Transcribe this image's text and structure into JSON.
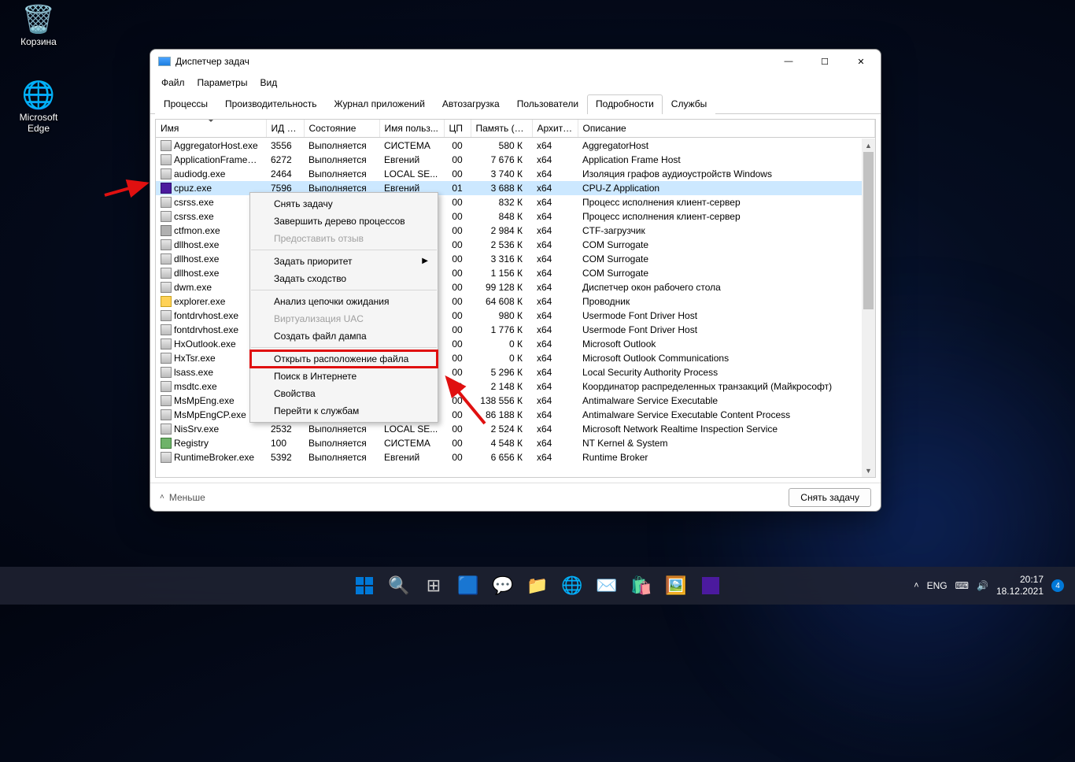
{
  "desktop": {
    "recycle": "Корзина",
    "edge": "Microsoft Edge"
  },
  "window": {
    "title": "Диспетчер задач",
    "menu": {
      "file": "Файл",
      "params": "Параметры",
      "view": "Вид"
    },
    "tabs": [
      "Процессы",
      "Производительность",
      "Журнал приложений",
      "Автозагрузка",
      "Пользователи",
      "Подробности",
      "Службы"
    ],
    "activeTab": 5,
    "headers": [
      "Имя",
      "ИД п...",
      "Состояние",
      "Имя польз...",
      "ЦП",
      "Память (а...",
      "Архите...",
      "Описание"
    ],
    "rows": [
      {
        "ic": "exe",
        "name": "AggregatorHost.exe",
        "pid": "3556",
        "state": "Выполняется",
        "user": "СИСТЕМА",
        "cpu": "00",
        "mem": "580 К",
        "arch": "x64",
        "desc": "AggregatorHost"
      },
      {
        "ic": "exe",
        "name": "ApplicationFrameHo...",
        "pid": "6272",
        "state": "Выполняется",
        "user": "Евгений",
        "cpu": "00",
        "mem": "7 676 К",
        "arch": "x64",
        "desc": "Application Frame Host"
      },
      {
        "ic": "exe",
        "name": "audiodg.exe",
        "pid": "2464",
        "state": "Выполняется",
        "user": "LOCAL SE...",
        "cpu": "00",
        "mem": "3 740 К",
        "arch": "x64",
        "desc": "Изоляция графов аудиоустройств Windows"
      },
      {
        "ic": "cpuz",
        "name": "cpuz.exe",
        "pid": "7596",
        "state": "Выполняется",
        "user": "Евгений",
        "cpu": "01",
        "mem": "3 688 К",
        "arch": "x64",
        "desc": "CPU-Z Application",
        "sel": true
      },
      {
        "ic": "exe",
        "name": "csrss.exe",
        "pid": "",
        "state": "",
        "user": "",
        "cpu": "00",
        "mem": "832 К",
        "arch": "x64",
        "desc": "Процесс исполнения клиент-сервер"
      },
      {
        "ic": "exe",
        "name": "csrss.exe",
        "pid": "",
        "state": "",
        "user": "",
        "cpu": "00",
        "mem": "848 К",
        "arch": "x64",
        "desc": "Процесс исполнения клиент-сервер"
      },
      {
        "ic": "pen",
        "name": "ctfmon.exe",
        "pid": "",
        "state": "",
        "user": "",
        "cpu": "00",
        "mem": "2 984 К",
        "arch": "x64",
        "desc": "CTF-загрузчик"
      },
      {
        "ic": "exe",
        "name": "dllhost.exe",
        "pid": "",
        "state": "",
        "user": "",
        "cpu": "00",
        "mem": "2 536 К",
        "arch": "x64",
        "desc": "COM Surrogate"
      },
      {
        "ic": "exe",
        "name": "dllhost.exe",
        "pid": "",
        "state": "",
        "user": "",
        "cpu": "00",
        "mem": "3 316 К",
        "arch": "x64",
        "desc": "COM Surrogate"
      },
      {
        "ic": "exe",
        "name": "dllhost.exe",
        "pid": "",
        "state": "",
        "user": "",
        "cpu": "00",
        "mem": "1 156 К",
        "arch": "x64",
        "desc": "COM Surrogate"
      },
      {
        "ic": "exe",
        "name": "dwm.exe",
        "pid": "",
        "state": "",
        "user": "",
        "cpu": "00",
        "mem": "99 128 К",
        "arch": "x64",
        "desc": "Диспетчер окон рабочего стола"
      },
      {
        "ic": "fold",
        "name": "explorer.exe",
        "pid": "",
        "state": "",
        "user": "",
        "cpu": "00",
        "mem": "64 608 К",
        "arch": "x64",
        "desc": "Проводник"
      },
      {
        "ic": "exe",
        "name": "fontdrvhost.exe",
        "pid": "",
        "state": "",
        "user": "",
        "cpu": "00",
        "mem": "980 К",
        "arch": "x64",
        "desc": "Usermode Font Driver Host"
      },
      {
        "ic": "exe",
        "name": "fontdrvhost.exe",
        "pid": "",
        "state": "",
        "user": "",
        "cpu": "00",
        "mem": "1 776 К",
        "arch": "x64",
        "desc": "Usermode Font Driver Host"
      },
      {
        "ic": "exe",
        "name": "HxOutlook.exe",
        "pid": "",
        "state": "",
        "user": "",
        "cpu": "00",
        "mem": "0 К",
        "arch": "x64",
        "desc": "Microsoft Outlook"
      },
      {
        "ic": "exe",
        "name": "HxTsr.exe",
        "pid": "",
        "state": "",
        "user": "",
        "cpu": "00",
        "mem": "0 К",
        "arch": "x64",
        "desc": "Microsoft Outlook Communications"
      },
      {
        "ic": "exe",
        "name": "lsass.exe",
        "pid": "",
        "state": "",
        "user": "",
        "cpu": "00",
        "mem": "5 296 К",
        "arch": "x64",
        "desc": "Local Security Authority Process"
      },
      {
        "ic": "exe",
        "name": "msdtc.exe",
        "pid": "",
        "state": "",
        "user": "",
        "cpu": "00",
        "mem": "2 148 К",
        "arch": "x64",
        "desc": "Координатор распределенных транзакций (Майкрософт)"
      },
      {
        "ic": "exe",
        "name": "MsMpEng.exe",
        "pid": "",
        "state": "",
        "user": "",
        "cpu": "00",
        "mem": "138 556 К",
        "arch": "x64",
        "desc": "Antimalware Service Executable"
      },
      {
        "ic": "exe",
        "name": "MsMpEngCP.exe",
        "pid": "2952",
        "state": "Выполняется",
        "user": "СИСТЕМА",
        "cpu": "00",
        "mem": "86 188 К",
        "arch": "x64",
        "desc": "Antimalware Service Executable Content Process"
      },
      {
        "ic": "exe",
        "name": "NisSrv.exe",
        "pid": "2532",
        "state": "Выполняется",
        "user": "LOCAL SE...",
        "cpu": "00",
        "mem": "2 524 К",
        "arch": "x64",
        "desc": "Microsoft Network Realtime Inspection Service"
      },
      {
        "ic": "reg",
        "name": "Registry",
        "pid": "100",
        "state": "Выполняется",
        "user": "СИСТЕМА",
        "cpu": "00",
        "mem": "4 548 К",
        "arch": "x64",
        "desc": "NT Kernel & System"
      },
      {
        "ic": "exe",
        "name": "RuntimeBroker.exe",
        "pid": "5392",
        "state": "Выполняется",
        "user": "Евгений",
        "cpu": "00",
        "mem": "6 656 К",
        "arch": "x64",
        "desc": "Runtime Broker"
      }
    ],
    "footer": {
      "less": "Меньше",
      "endtask": "Снять задачу"
    }
  },
  "ctx": {
    "items": [
      {
        "t": "Снять задачу"
      },
      {
        "t": "Завершить дерево процессов"
      },
      {
        "t": "Предоставить отзыв",
        "dis": true
      },
      {
        "sep": true
      },
      {
        "t": "Задать приоритет",
        "sub": true
      },
      {
        "t": "Задать сходство"
      },
      {
        "sep": true
      },
      {
        "t": "Анализ цепочки ожидания"
      },
      {
        "t": "Виртуализация UAC",
        "dis": true
      },
      {
        "t": "Создать файл дампа"
      },
      {
        "sep": true
      },
      {
        "t": "Открыть расположение файла",
        "hl": true
      },
      {
        "t": "Поиск в Интернете"
      },
      {
        "t": "Свойства"
      },
      {
        "t": "Перейти к службам"
      }
    ]
  },
  "tray": {
    "lang": "ENG",
    "time": "20:17",
    "date": "18.12.2021",
    "badge": "4"
  }
}
